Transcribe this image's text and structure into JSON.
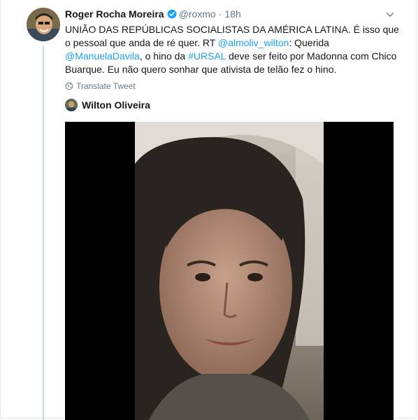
{
  "tweet": {
    "author_name": "Roger Rocha Moreira",
    "author_handle": "@roxmo",
    "separator": "·",
    "time": "18h",
    "text_part1": "UNIÃO DAS REPÚBLICAS SOCIALISTAS DA AMÉRICA LATINA. É isso que o pessoal que anda de ré quer. RT ",
    "mention1": "@almoliv_wilton",
    "text_part2": ": Querida ",
    "mention2": "@ManuelaDavila",
    "text_part3": ", o hino da ",
    "hashtag": "#URSAL",
    "text_part4": " deve ser feito por Madonna com Chico Buarque. Eu não quero sonhar que ativista de telão fez o hino.",
    "translate_label": "Translate Tweet"
  },
  "quoted": {
    "name": "Wilton Oliveira"
  },
  "colors": {
    "link": "#1da1f2",
    "secondary_text": "#657786",
    "thread_line": "#ccd6dd",
    "verified_badge": "#1da1f2"
  },
  "icons": {
    "verified": "verified-badge-icon",
    "caret": "chevron-down-icon",
    "translate": "globe-icon"
  }
}
